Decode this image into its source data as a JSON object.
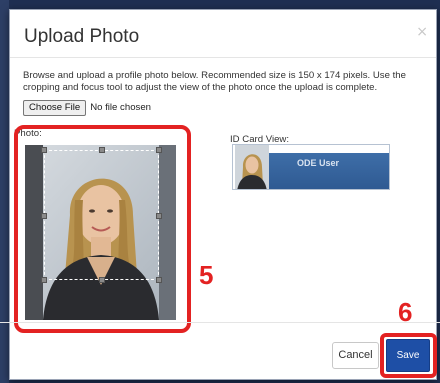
{
  "dialog": {
    "title": "Upload Photo",
    "close_glyph": "×",
    "description": "Browse and upload a profile photo below. Recommended size is 150 x 174 pixels. Use the cropping and focus tool to adjust the view of the photo once the upload is complete.",
    "file_input": {
      "button_label": "Choose File",
      "status": "No file chosen"
    },
    "photo": {
      "label": "Photo:"
    },
    "id_card": {
      "label": "ID Card View:",
      "name": "ODE User"
    },
    "footer": {
      "cancel_label": "Cancel",
      "save_label": "Save"
    }
  },
  "annotations": {
    "step_photo": "5",
    "step_save": "6"
  },
  "colors": {
    "annotation": "#e32222",
    "primary_button": "#1e4fa6",
    "id_card_band": "#3e6ea8",
    "page_backdrop": "#1f2f52"
  }
}
